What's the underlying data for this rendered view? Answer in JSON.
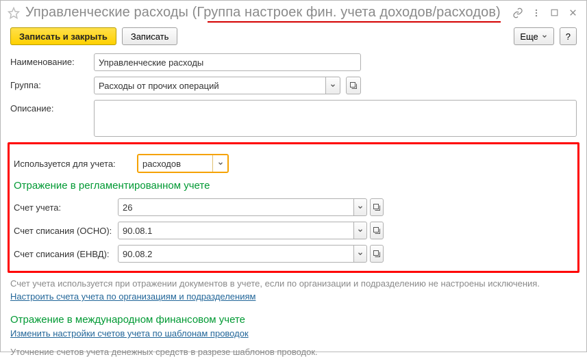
{
  "titlebar": {
    "title": "Управленческие расходы (Группа настроек фин. учета доходов/расходов)"
  },
  "toolbar": {
    "save_close_label": "Записать и закрыть",
    "save_label": "Записать",
    "more_label": "Еще",
    "help_label": "?"
  },
  "form": {
    "name_label": "Наименование:",
    "name_value": "Управленческие расходы",
    "group_label": "Группа:",
    "group_value": "Расходы от прочих операций",
    "desc_label": "Описание:",
    "desc_value": ""
  },
  "used_for": {
    "label": "Используется для учета:",
    "value": "расходов"
  },
  "reg_section": {
    "title": "Отражение в регламентированном учете",
    "rows": [
      {
        "label": "Счет учета:",
        "value": "26"
      },
      {
        "label": "Счет списания (ОСНО):",
        "value": "90.08.1"
      },
      {
        "label": "Счет списания (ЕНВД):",
        "value": "90.08.2"
      }
    ]
  },
  "footer": {
    "note1": "Счет учета используется при отражении документов в учете, если по организации и подразделению не настроены исключения.",
    "link1": "Настроить счета учета по организациям и подразделениям",
    "ifrs_title": "Отражение в международном финансовом учете",
    "link2": "Изменить настройки счетов учета по шаблонам проводок",
    "note2": "Уточнение счетов учета денежных средств в разрезе шаблонов проводок."
  }
}
